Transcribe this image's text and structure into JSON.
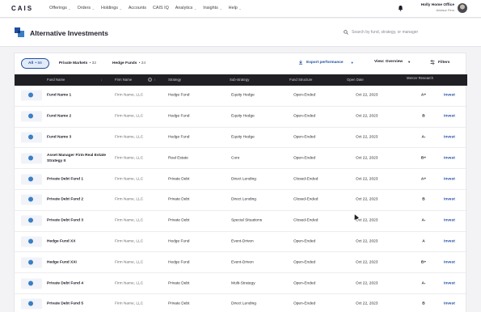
{
  "nav": {
    "logo": "CAIS",
    "items": [
      {
        "label": "Offerings",
        "dropdown": true
      },
      {
        "label": "Orders",
        "dropdown": true
      },
      {
        "label": "Holdings",
        "dropdown": true
      },
      {
        "label": "Accounts",
        "dropdown": false
      },
      {
        "label": "CAIS IQ",
        "dropdown": false
      },
      {
        "label": "Analytics",
        "dropdown": true
      },
      {
        "label": "Insights",
        "dropdown": true
      },
      {
        "label": "Help",
        "dropdown": true
      }
    ],
    "user_name": "Holly Home Office",
    "user_role": "Advisor Firm"
  },
  "page": {
    "title": "Alternative Investments",
    "search_placeholder": "Search by fund, strategy, or manager"
  },
  "filters": [
    {
      "label": "All",
      "count": "• 56",
      "active": true
    },
    {
      "label": "Private Markets",
      "count": "• 32",
      "active": false
    },
    {
      "label": "Hedge Funds",
      "count": "• 24",
      "active": false
    }
  ],
  "toolbar": {
    "export_label": "Export performance",
    "view_label": "View: Overview",
    "filters_label": "Filters"
  },
  "table": {
    "headers": {
      "fund_name": "Fund Name",
      "firm_name": "Firm Name",
      "strategy": "Strategy",
      "sub_strategy": "Sub-strategy",
      "fund_structure": "Fund Structure",
      "open_date": "Open Date",
      "mercer": "Mercer Research"
    },
    "rows": [
      {
        "name": "Fund Name 1",
        "firm": "Firm Name, LLC",
        "strategy": "Hedge Fund",
        "sub": "Equity Hedge",
        "structure": "Open-Ended",
        "date": "Oct 22, 2023",
        "mercer": "A+",
        "action": "Invest"
      },
      {
        "name": "Fund Name 2",
        "firm": "Firm Name, LLC",
        "strategy": "Hedge Fund",
        "sub": "Equity Hedge",
        "structure": "Open-Ended",
        "date": "Oct 22, 2023",
        "mercer": "B",
        "action": "Invest"
      },
      {
        "name": "Fund Name 3",
        "firm": "Firm Name, LLC",
        "strategy": "Hedge Fund",
        "sub": "Equity Hedge",
        "structure": "Open-Ended",
        "date": "Oct 22, 2023",
        "mercer": "A-",
        "action": "Invest"
      },
      {
        "name": "Asset Manager Firm Real Estate Strategy II",
        "firm": "Firm Name, LLC",
        "strategy": "Real Estate",
        "sub": "Core",
        "structure": "Open-Ended",
        "date": "Oct 22, 2023",
        "mercer": "B+",
        "action": "Invest"
      },
      {
        "name": "Private Debt Fund 1",
        "firm": "Firm Name, LLC",
        "strategy": "Private Debt",
        "sub": "Direct Lending",
        "structure": "Closed-Ended",
        "date": "Oct 22, 2023",
        "mercer": "A+",
        "action": "Invest"
      },
      {
        "name": "Private Debt Fund 2",
        "firm": "Firm Name, LLC",
        "strategy": "Private Debt",
        "sub": "Direct Lending",
        "structure": "Closed-Ended",
        "date": "Oct 22, 2023",
        "mercer": "B",
        "action": "Invest"
      },
      {
        "name": "Private Debt Fund 3",
        "firm": "Firm Name, LLC",
        "strategy": "Private Debt",
        "sub": "Special Situations",
        "structure": "Closed-Ended",
        "date": "Oct 22, 2023",
        "mercer": "A-",
        "action": "Invest"
      },
      {
        "name": "Hedge Fund XX",
        "firm": "Firm Name, LLC",
        "strategy": "Hedge Fund",
        "sub": "Event-Driven",
        "structure": "Open-Ended",
        "date": "Oct 22, 2023",
        "mercer": "A",
        "action": "Invest"
      },
      {
        "name": "Hedge Fund XXI",
        "firm": "Firm Name, LLC",
        "strategy": "Hedge Fund",
        "sub": "Event-Driven",
        "structure": "Open-Ended",
        "date": "Oct 22, 2023",
        "mercer": "B+",
        "action": "Invest"
      },
      {
        "name": "Private Debt Fund 4",
        "firm": "Firm Name, LLC",
        "strategy": "Private Debt",
        "sub": "Multi-Strategy",
        "structure": "Open-Ended",
        "date": "Oct 22, 2023",
        "mercer": "A-",
        "action": "Invest"
      },
      {
        "name": "Private Debt Fund 5",
        "firm": "Firm Name, LLC",
        "strategy": "Private Debt",
        "sub": "Direct Lending",
        "structure": "Open-Ended",
        "date": "Oct 22, 2023",
        "mercer": "B",
        "action": "Invest"
      }
    ]
  },
  "colors": {
    "accent": "#1e4fa3",
    "header_bg": "#1f1f24",
    "page_bg": "#f3f3f5"
  }
}
